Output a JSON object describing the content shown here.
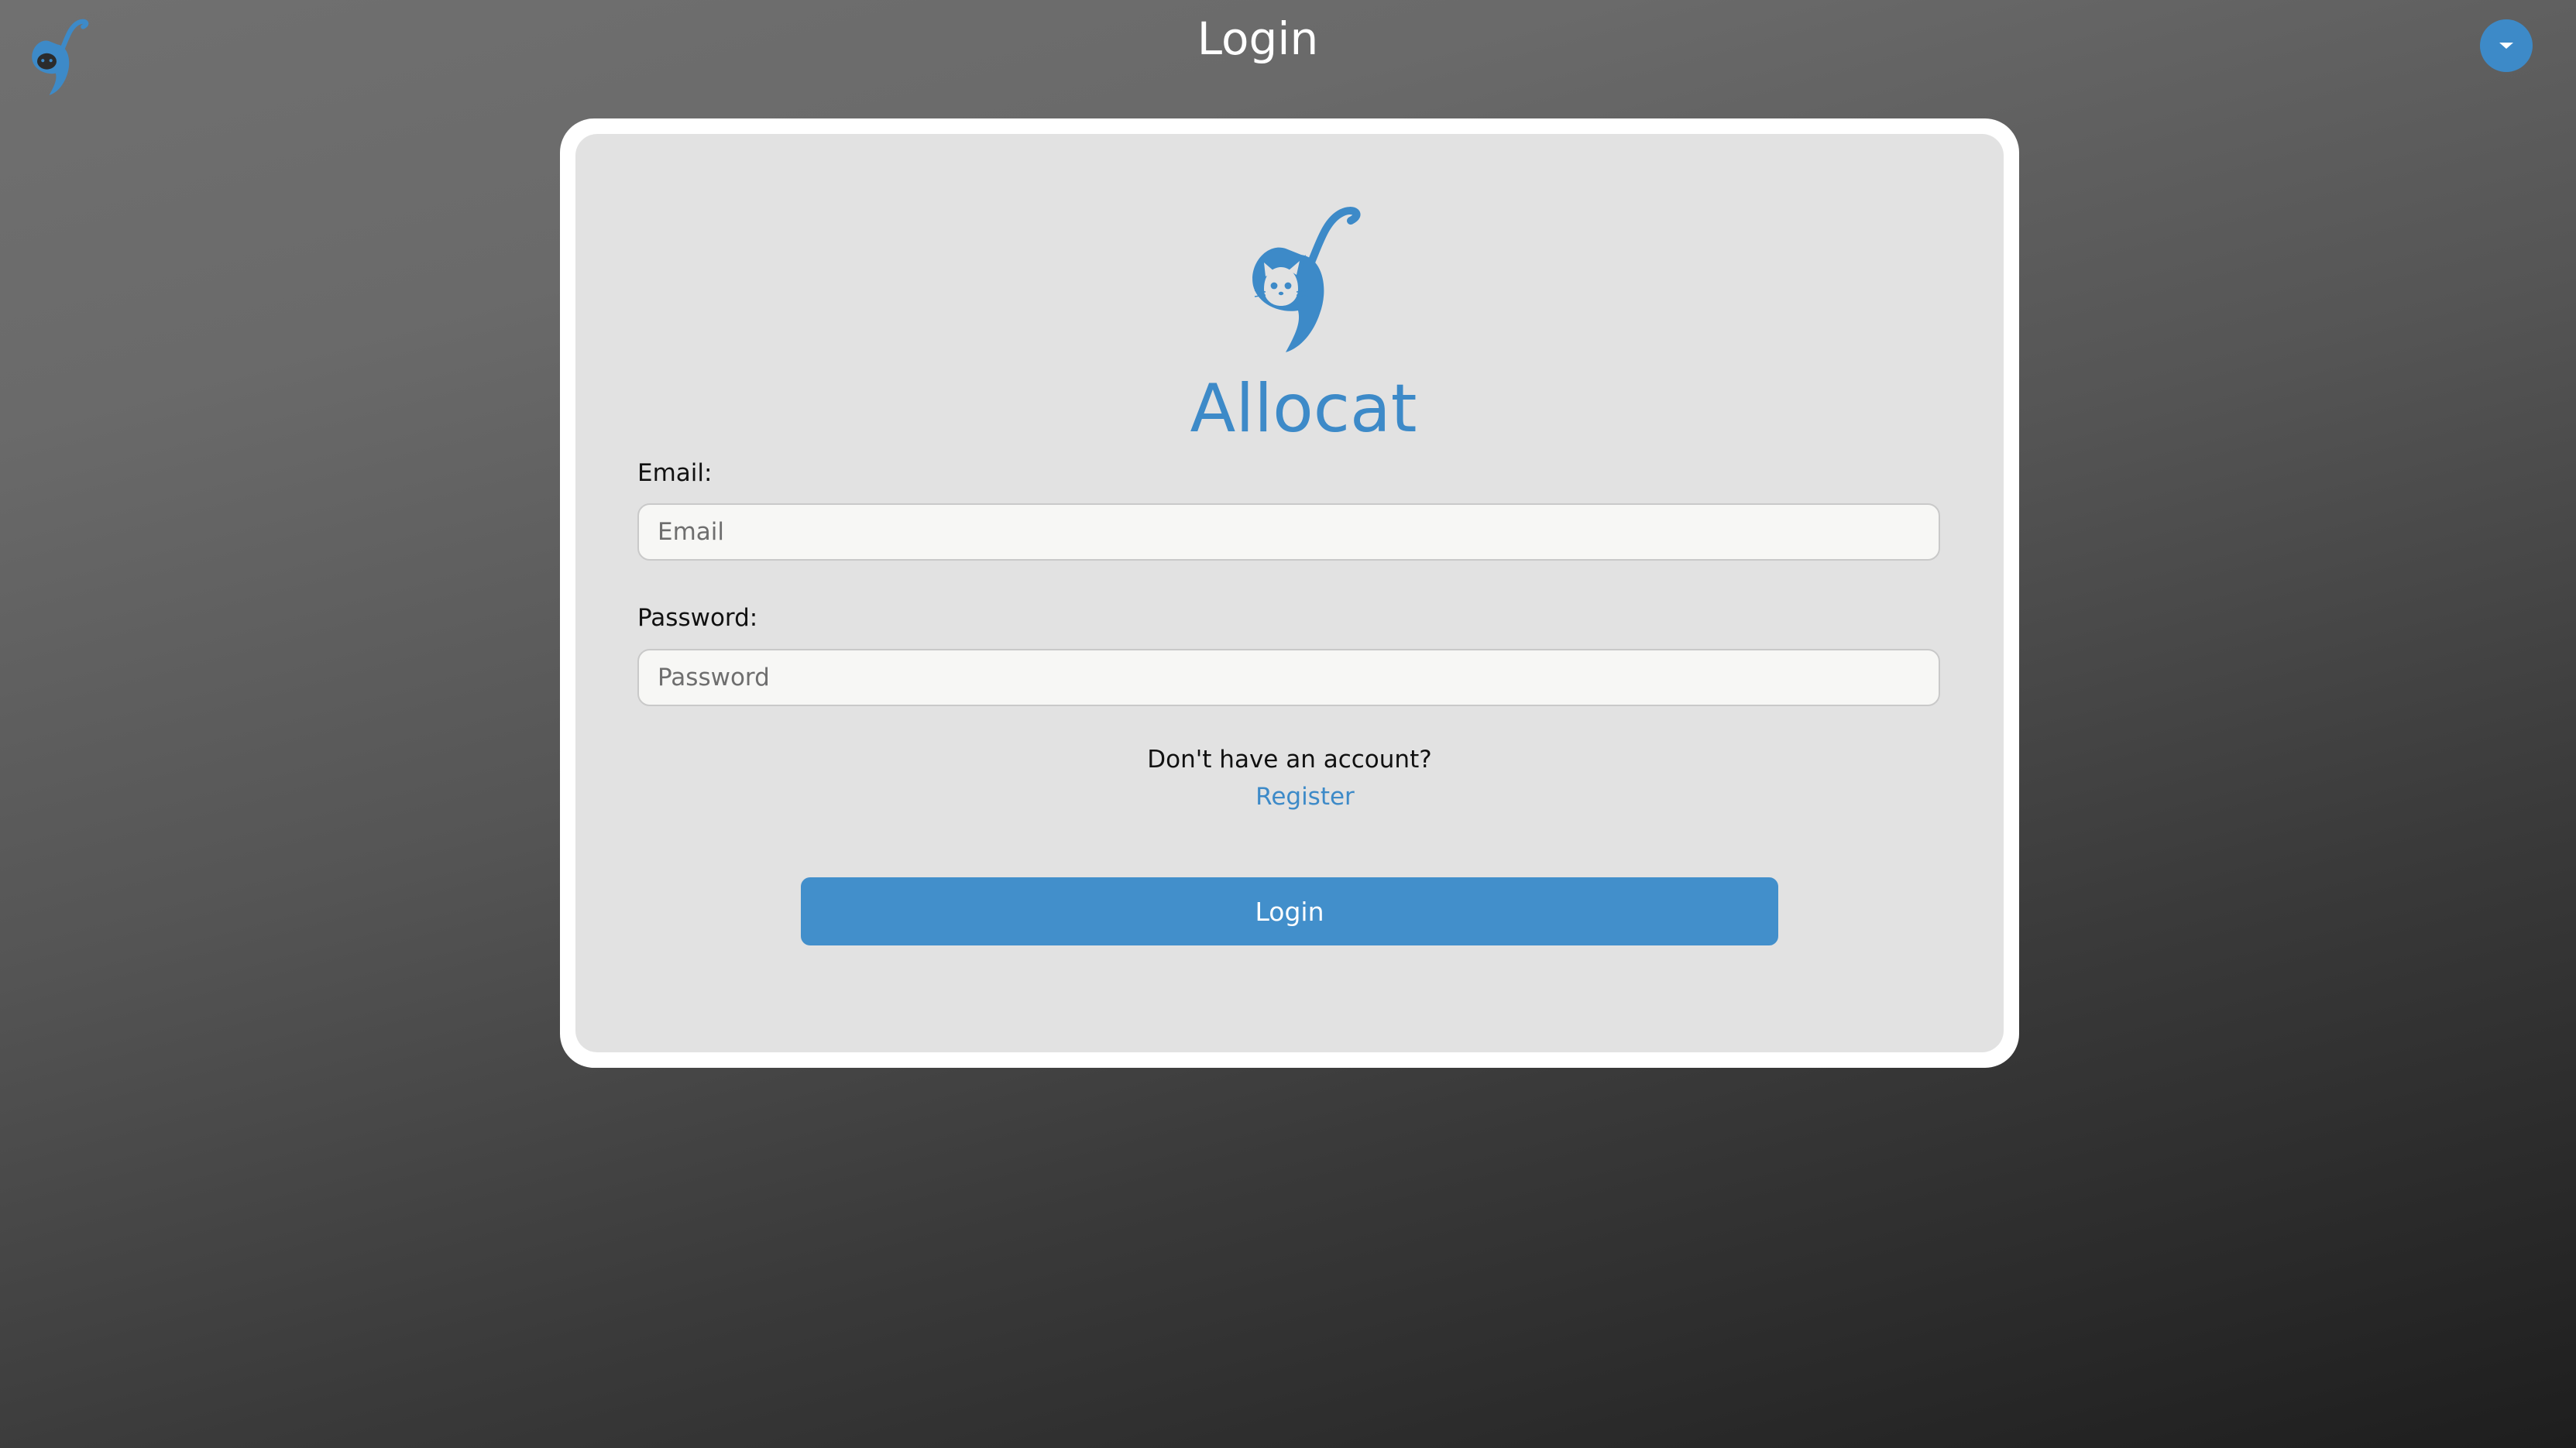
{
  "header": {
    "title": "Login",
    "logo_icon": "cat-logo-icon",
    "menu_icon": "caret-down-icon"
  },
  "card": {
    "brand_icon": "cat-logo-icon",
    "brand_name": "Allocat",
    "email": {
      "label": "Email:",
      "placeholder": "Email",
      "value": ""
    },
    "password": {
      "label": "Password:",
      "placeholder": "Password",
      "value": ""
    },
    "register_prompt": "Don't have an account?",
    "register_link": "Register",
    "login_button": "Login"
  },
  "colors": {
    "accent": "#428fcb",
    "card_bg": "#e2e2e2",
    "card_border": "#ffffff"
  }
}
